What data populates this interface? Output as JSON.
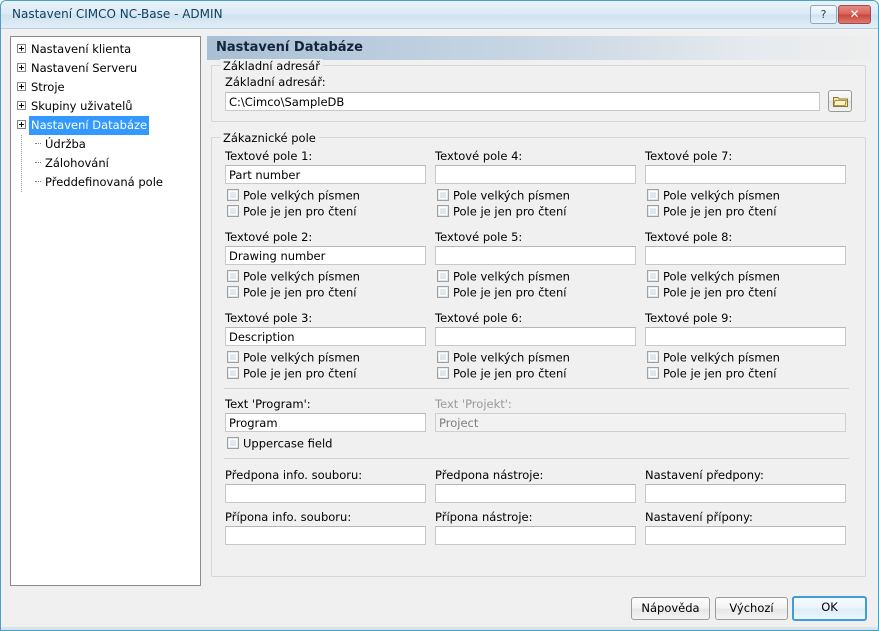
{
  "window": {
    "title": "Nastavení CIMCO NC-Base - ADMIN",
    "help_button": "?",
    "close_button": "✕"
  },
  "tree": {
    "items": [
      {
        "label": "Nastavení klienta",
        "expandable": true,
        "selected": false
      },
      {
        "label": "Nastavení Serveru",
        "expandable": true,
        "selected": false
      },
      {
        "label": "Stroje",
        "expandable": true,
        "selected": false
      },
      {
        "label": "Skupiny uživatelů",
        "expandable": true,
        "selected": false
      },
      {
        "label": "Nastavení Databáze",
        "expandable": true,
        "selected": true
      }
    ],
    "children": [
      {
        "label": "Údržba"
      },
      {
        "label": "Zálohování"
      },
      {
        "label": "Předdefinovaná pole"
      }
    ]
  },
  "page": {
    "header": "Nastavení Databáze"
  },
  "base_dir_group": {
    "title": "Základní adresář",
    "label": "Základní adresář:",
    "value": "C:\\Cimco\\SampleDB",
    "browse_icon": "folder-icon"
  },
  "customer_group": {
    "title": "Zákaznické pole",
    "checkbox_uppercase": "Pole velkých písmen",
    "checkbox_readonly": "Pole je jen pro čtení",
    "fields": [
      {
        "label": "Textové pole 1:",
        "value": "Part number"
      },
      {
        "label": "Textové pole 2:",
        "value": "Drawing number"
      },
      {
        "label": "Textové pole 3:",
        "value": "Description"
      },
      {
        "label": "Textové pole 4:",
        "value": ""
      },
      {
        "label": "Textové pole 5:",
        "value": ""
      },
      {
        "label": "Textové pole 6:",
        "value": ""
      },
      {
        "label": "Textové pole 7:",
        "value": ""
      },
      {
        "label": "Textové pole 8:",
        "value": ""
      },
      {
        "label": "Textové pole 9:",
        "value": ""
      }
    ],
    "program_label": "Text 'Program':",
    "program_value": "Program",
    "project_label": "Text 'Projekt':",
    "project_value": "Project",
    "uppercase_field": "Uppercase field",
    "prefix_fields": [
      {
        "label": "Předpona info. souboru:",
        "value": ""
      },
      {
        "label": "Předpona nástroje:",
        "value": ""
      },
      {
        "label": "Nastavení předpony:",
        "value": ""
      },
      {
        "label": "Přípona info. souboru:",
        "value": ""
      },
      {
        "label": "Přípona nástroje:",
        "value": ""
      },
      {
        "label": "Nastavení přípony:",
        "value": ""
      }
    ]
  },
  "footer": {
    "help": "Nápověda",
    "default": "Výchozí",
    "ok": "OK"
  }
}
